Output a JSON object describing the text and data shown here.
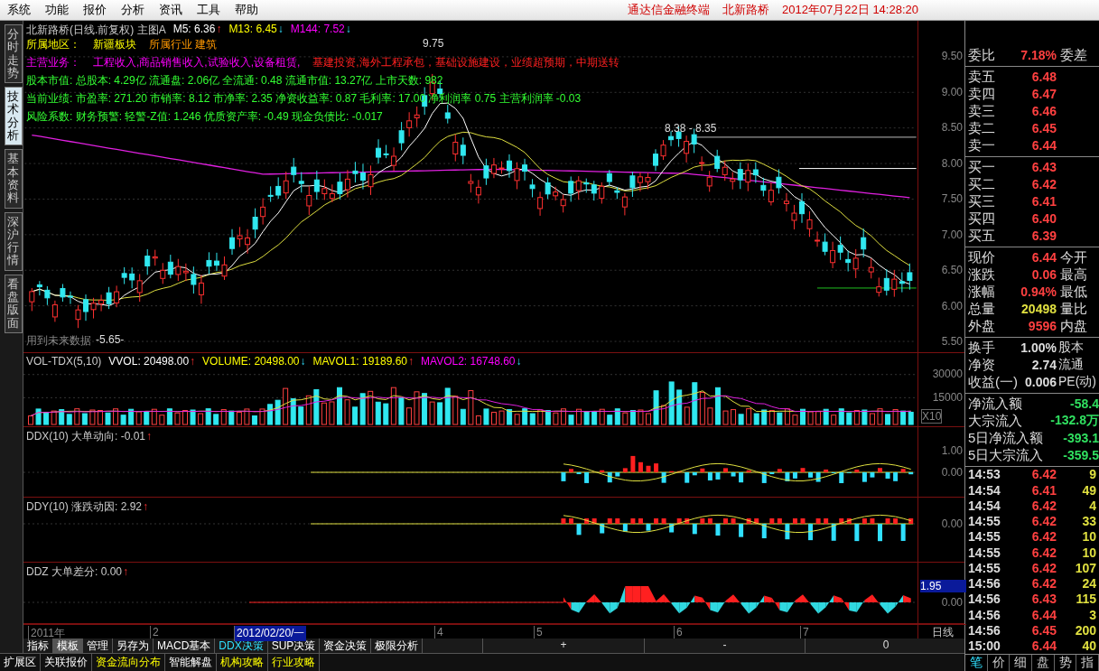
{
  "menu_bar": {
    "items": [
      "系统",
      "功能",
      "报价",
      "分析",
      "资讯",
      "工具",
      "帮助"
    ],
    "app_name": "通达信金融终端",
    "stock_name": "北新路桥",
    "datetime": "2012年07月22日 14:28:20"
  },
  "side_tabs": [
    {
      "label": "分时走势",
      "selected": false
    },
    {
      "label": "技术分析",
      "selected": true
    },
    {
      "label": "基本资料",
      "selected": false
    },
    {
      "label": "深沪行情",
      "selected": false
    },
    {
      "label": "看盘版面",
      "selected": false
    }
  ],
  "price_panel": {
    "title": "北新路桥(日线.前复权) 主图A",
    "indicators": [
      {
        "label": "M5: 6.36",
        "arrow": "↑",
        "kind": "rise",
        "color": "#ffffff"
      },
      {
        "label": "M13: 6.45",
        "arrow": "↓",
        "kind": "fall",
        "color": "#ffff00"
      },
      {
        "label": "M144: 7.52",
        "arrow": "↓",
        "kind": "fall",
        "color": "#ff00ff"
      }
    ],
    "info_lines": [
      [
        {
          "text": "所属地区：",
          "kind": "region"
        },
        {
          "text": "新疆板块",
          "kind": "region"
        },
        {
          "text": "所属行业 建筑",
          "kind": "industry"
        }
      ],
      [
        {
          "text": "主营业务：",
          "kind": "business"
        },
        {
          "text": "工程收入,商品销售收入,试验收入,设备租赁,",
          "kind": "business"
        },
        {
          "text": "基建投资,海外工程承包，基础设施建设，业绩超预期，中期送转",
          "kind": "highlight"
        }
      ],
      [
        {
          "text": "股本市值: 总股本: 4.29亿 流通盘: 2.06亿 全流通: 0.48 流通市值: 13.27亿 上市天数: 982",
          "kind": "metric"
        }
      ],
      [
        {
          "text": "当前业绩: 市盈率: 271.20 市销率: 8.12 市净率: 2.35 净资收益率: 0.87 毛利率: 17.00 净利润率 0.75 主营利润率 -0.03",
          "kind": "metric"
        }
      ],
      [
        {
          "text": "风险系数: 财务预警: 轻警-Z值: 1.246 优质资产率: -0.49 现金负债比: -0.017",
          "kind": "metric"
        }
      ]
    ],
    "peak_label": "9.75",
    "range_label": "8.38 - 8.35",
    "warning": "用到未来数据",
    "low_label": "-5.65-",
    "axis": [
      "9.50",
      "9.00",
      "8.50",
      "8.00",
      "7.50",
      "7.00",
      "6.50",
      "6.00",
      "5.50"
    ]
  },
  "volume_panel": {
    "name": "VOL-TDX(5,10)",
    "indicators": [
      {
        "label": "VVOL: 20498.00",
        "arrow": "↑",
        "kind": "rise",
        "color": "#ffffff"
      },
      {
        "label": "VOLUME: 20498.00",
        "arrow": "↓",
        "kind": "fall",
        "color": "#ffff00"
      },
      {
        "label": "MAVOL1: 19189.60",
        "arrow": "↑",
        "kind": "rise",
        "color": "#ffff00"
      },
      {
        "label": "MAVOL2: 16748.60",
        "arrow": "↓",
        "kind": "fall",
        "color": "#ff00ff"
      }
    ],
    "axis": [
      "30000",
      "15000"
    ],
    "scale": "X10"
  },
  "ddx_panel": {
    "label": "DDX(10) 大单动向: -0.01",
    "arrow": "↑",
    "axis": [
      "1.00",
      "0.00"
    ]
  },
  "ddy_panel": {
    "label": "DDY(10) 涨跌动因: 2.92",
    "arrow": "↑",
    "axis": [
      "0.00"
    ]
  },
  "ddz_panel": {
    "label": "DDZ 大单差分: 0.00",
    "arrow": "↑",
    "axis": [
      "1.95",
      "0.00"
    ]
  },
  "x_axis": [
    {
      "label": "2011年",
      "selected": false
    },
    {
      "label": "2",
      "selected": false
    },
    {
      "label": "2012/02/20/一",
      "selected": true
    },
    {
      "label": "4",
      "selected": false
    },
    {
      "label": "5",
      "selected": false
    },
    {
      "label": "6",
      "selected": false
    },
    {
      "label": "7",
      "selected": false
    }
  ],
  "period": "日线",
  "zoom_buttons": [
    "+",
    "-",
    "0"
  ],
  "indicator_tabs": [
    {
      "label": "指标",
      "selected": false,
      "highlighted": false
    },
    {
      "label": "模板",
      "selected": true,
      "highlighted": false
    },
    {
      "label": "管理",
      "selected": false,
      "highlighted": false
    },
    {
      "label": "另存为",
      "selected": false,
      "highlighted": false
    },
    {
      "label": "MACD基本",
      "selected": false,
      "highlighted": false
    },
    {
      "label": "DDX决策",
      "selected": false,
      "highlighted": true
    },
    {
      "label": "SUP决策",
      "selected": false,
      "highlighted": false
    },
    {
      "label": "资金决策",
      "selected": false,
      "highlighted": false
    },
    {
      "label": "极限分析",
      "selected": false,
      "highlighted": false
    }
  ],
  "extension_tabs": [
    {
      "label": "扩展区",
      "highlighted": false
    },
    {
      "label": "关联报价",
      "highlighted": false
    },
    {
      "label": "资金流向分布",
      "highlighted": true
    },
    {
      "label": "智能解盘",
      "highlighted": false
    },
    {
      "label": "机构攻略",
      "highlighted": true
    },
    {
      "label": "行业攻略",
      "highlighted": true
    }
  ],
  "quote": {
    "order_ratio": {
      "label": "委比",
      "value": "7.18%",
      "label2": "委差"
    },
    "asks": [
      {
        "label": "卖五",
        "price": "6.48"
      },
      {
        "label": "卖四",
        "price": "6.47"
      },
      {
        "label": "卖三",
        "price": "6.46"
      },
      {
        "label": "卖二",
        "price": "6.45"
      },
      {
        "label": "卖一",
        "price": "6.44"
      }
    ],
    "bids": [
      {
        "label": "买一",
        "price": "6.43"
      },
      {
        "label": "买二",
        "price": "6.42"
      },
      {
        "label": "买三",
        "price": "6.41"
      },
      {
        "label": "买四",
        "price": "6.40"
      },
      {
        "label": "买五",
        "price": "6.39"
      }
    ],
    "stats": [
      {
        "label": "现价",
        "value": "6.44",
        "label2": "今开",
        "color": "#ff4040"
      },
      {
        "label": "涨跌",
        "value": "0.06",
        "label2": "最高",
        "color": "#ff4040"
      },
      {
        "label": "涨幅",
        "value": "0.94%",
        "label2": "最低",
        "color": "#ff4040"
      },
      {
        "label": "总量",
        "value": "20498",
        "label2": "量比",
        "color": "#e0e040"
      },
      {
        "label": "外盘",
        "value": "9596",
        "label2": "内盘",
        "color": "#ff4040"
      }
    ],
    "fundamentals": [
      {
        "label": "换手",
        "value": "1.00%",
        "label2": "股本"
      },
      {
        "label": "净资",
        "value": "2.74",
        "label2": "流通"
      },
      {
        "label": "收益(一)",
        "value": "0.006",
        "label2": "PE(动)"
      }
    ],
    "flows": [
      {
        "label": "净流入额",
        "value": "-58.4"
      },
      {
        "label": "大宗流入",
        "value": "-132.8万"
      },
      {
        "label": "5日净流入额",
        "value": "-393.1"
      },
      {
        "label": "5日大宗流入",
        "value": "-359.5"
      }
    ],
    "ticks": [
      {
        "time": "14:53",
        "price": "6.42",
        "volume": "9"
      },
      {
        "time": "14:54",
        "price": "6.41",
        "volume": "49"
      },
      {
        "time": "14:54",
        "price": "6.42",
        "volume": "4"
      },
      {
        "time": "14:55",
        "price": "6.42",
        "volume": "33"
      },
      {
        "time": "14:55",
        "price": "6.42",
        "volume": "10"
      },
      {
        "time": "14:55",
        "price": "6.42",
        "volume": "10"
      },
      {
        "time": "14:55",
        "price": "6.42",
        "volume": "107"
      },
      {
        "time": "14:56",
        "price": "6.42",
        "volume": "24"
      },
      {
        "time": "14:56",
        "price": "6.43",
        "volume": "115"
      },
      {
        "time": "14:56",
        "price": "6.44",
        "volume": "3"
      },
      {
        "time": "14:56",
        "price": "6.45",
        "volume": "200"
      },
      {
        "time": "15:00",
        "price": "6.44",
        "volume": "40"
      }
    ],
    "tabs": [
      {
        "label": "笔",
        "selected": true
      },
      {
        "label": "价",
        "selected": false
      },
      {
        "label": "细",
        "selected": false
      },
      {
        "label": "盘",
        "selected": false
      },
      {
        "label": "势",
        "selected": false
      },
      {
        "label": "指",
        "selected": false
      }
    ]
  }
}
